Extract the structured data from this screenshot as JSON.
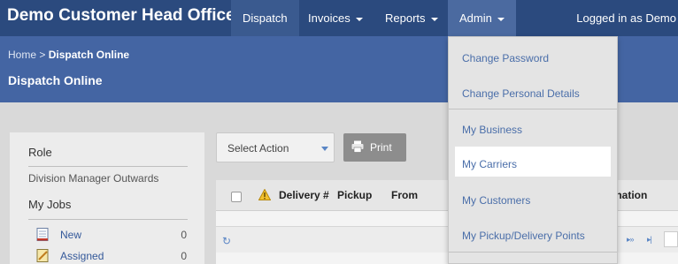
{
  "app": {
    "title": "Demo Customer Head Office",
    "colors": {
      "navbar": "#2b4a7e",
      "header": "#4465a3",
      "link": "#4a6ea9"
    }
  },
  "nav": {
    "items": [
      {
        "label": "Dispatch"
      },
      {
        "label": "Invoices"
      },
      {
        "label": "Reports"
      },
      {
        "label": "Admin"
      }
    ],
    "logged_in": "Logged in as Demo"
  },
  "breadcrumb": {
    "home": "Home",
    "separator": ">",
    "current": "Dispatch Online"
  },
  "page_title": "Dispatch Online",
  "sidebar": {
    "role_heading": "Role",
    "role_value": "Division Manager Outwards",
    "jobs_heading": "My Jobs",
    "jobs": [
      {
        "label": "New",
        "count": "0",
        "icon": "document-icon"
      },
      {
        "label": "Assigned",
        "count": "0",
        "icon": "pencil-document-icon"
      }
    ]
  },
  "toolbar": {
    "select_action": "Select Action",
    "print": "Print"
  },
  "grid": {
    "columns": [
      "Delivery #",
      "Pickup",
      "From",
      "ination"
    ]
  },
  "admin_menu": {
    "items": [
      {
        "label": "Change Password"
      },
      {
        "label": "Change Personal Details"
      },
      {
        "label": "My Business"
      },
      {
        "label": "My Carriers"
      },
      {
        "label": "My Customers"
      },
      {
        "label": "My Pickup/Delivery Points"
      }
    ]
  }
}
